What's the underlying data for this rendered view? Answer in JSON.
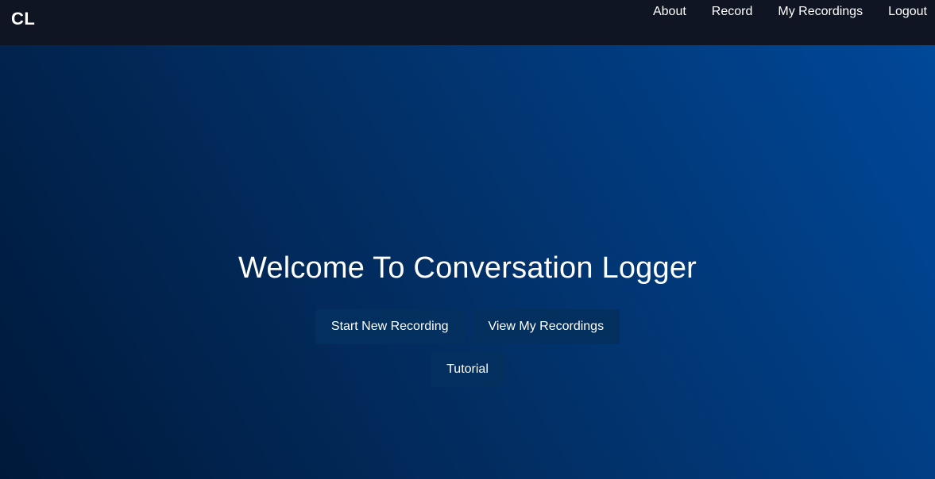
{
  "navbar": {
    "brand": "CL",
    "links": [
      {
        "label": "About"
      },
      {
        "label": "Record"
      },
      {
        "label": "My Recordings"
      },
      {
        "label": "Logout"
      }
    ]
  },
  "hero": {
    "title": "Welcome To Conversation Logger",
    "buttons": {
      "start_recording": "Start New Recording",
      "view_recordings": "View My Recordings",
      "tutorial": "Tutorial"
    }
  },
  "colors": {
    "navbar_background": "#0f1522",
    "hero_gradient_start": "#00193a",
    "hero_gradient_end": "#004899",
    "button_background": "#03305f",
    "text": "#ffffff"
  }
}
